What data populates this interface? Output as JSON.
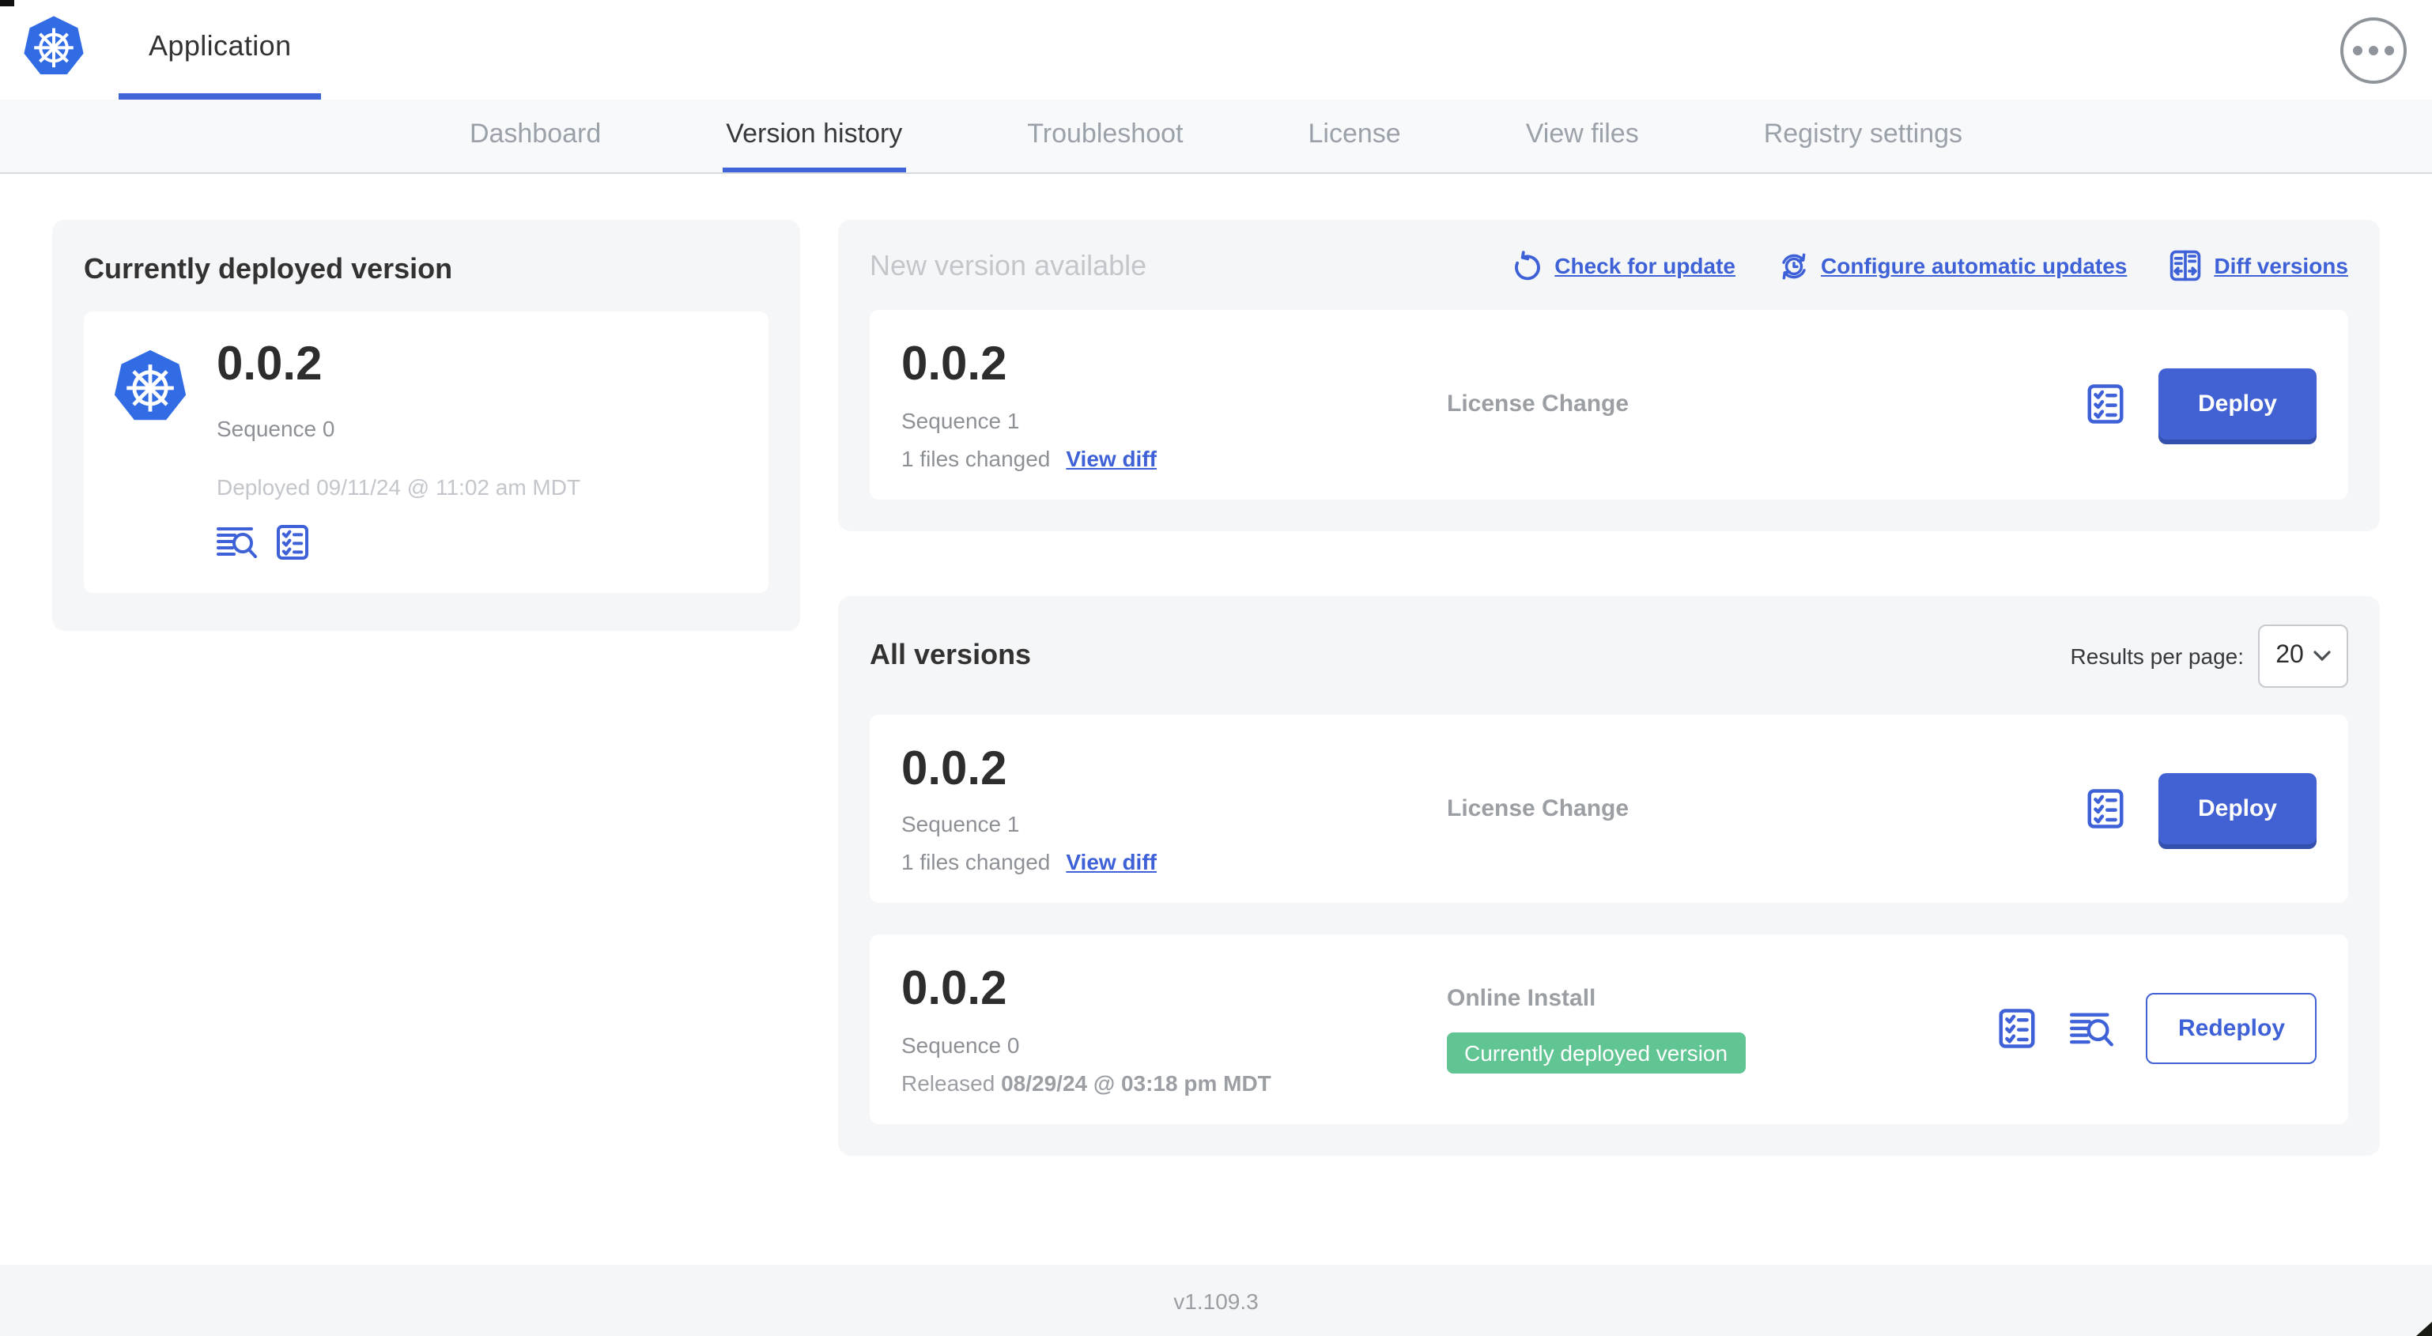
{
  "header": {
    "app_title": "Application"
  },
  "tabs": [
    {
      "label": "Dashboard",
      "active": false
    },
    {
      "label": "Version history",
      "active": true
    },
    {
      "label": "Troubleshoot",
      "active": false
    },
    {
      "label": "License",
      "active": false
    },
    {
      "label": "View files",
      "active": false
    },
    {
      "label": "Registry settings",
      "active": false
    }
  ],
  "deployed_card": {
    "title": "Currently deployed version",
    "version": "0.0.2",
    "sequence": "Sequence 0",
    "deployed_at": "Deployed 09/11/24 @ 11:02 am MDT"
  },
  "new_version": {
    "title": "New version available",
    "actions": [
      {
        "label": "Check for update",
        "icon": "refresh-icon"
      },
      {
        "label": "Configure automatic updates",
        "icon": "clock-sync-icon"
      },
      {
        "label": "Diff versions",
        "icon": "diff-icon"
      }
    ],
    "row": {
      "version": "0.0.2",
      "sequence": "Sequence 1",
      "files_changed": "1 files changed",
      "view_diff_label": "View diff",
      "source": "License Change",
      "deploy_label": "Deploy"
    }
  },
  "all_versions": {
    "title": "All versions",
    "results_per_page_label": "Results per page:",
    "results_per_page_value": "20",
    "rows": [
      {
        "version": "0.0.2",
        "sequence": "Sequence 1",
        "files_changed": "1 files changed",
        "view_diff_label": "View diff",
        "source": "License Change",
        "action_label": "Deploy"
      },
      {
        "version": "0.0.2",
        "sequence": "Sequence 0",
        "released_prefix": "Released ",
        "released_date": "08/29/24 @ 03:18 pm MDT",
        "source": "Online Install",
        "badge": "Currently deployed version",
        "action_label": "Redeploy"
      }
    ]
  },
  "footer": {
    "version": "v1.109.3"
  },
  "colors": {
    "accent_blue": "#3e61d8",
    "button_blue": "#4262d4",
    "kubernetes_blue": "#326ce5",
    "badge_green": "#61c493",
    "card_gray": "#f4f6f8"
  }
}
